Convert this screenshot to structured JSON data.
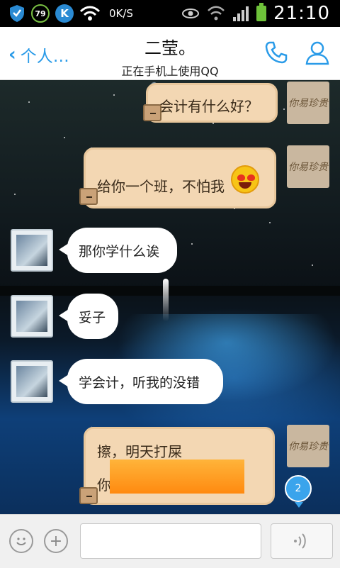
{
  "status_bar": {
    "battery_level_text": "79",
    "k_badge": "K",
    "net_speed": "0K/S",
    "time": "21:10"
  },
  "header": {
    "back_label": "个人…",
    "title": "二莹。",
    "subtitle": "正在手机上使用QQ"
  },
  "messages": [
    {
      "side": "right",
      "text": "会计有什么好？",
      "avatar_text": "你易珍贵"
    },
    {
      "side": "right",
      "text": "给你一个班，不怕我",
      "avatar_text": "你易珍贵",
      "emoji": "heart-eyes-emoji"
    },
    {
      "side": "left",
      "text": "那你学什么诶"
    },
    {
      "side": "left",
      "text": "妥子"
    },
    {
      "side": "left",
      "text": "学会计，听我的没错"
    },
    {
      "side": "right",
      "text": "擦，明天打屎",
      "text2": "你",
      "avatar_text": "你易珍贵"
    }
  ],
  "unread_badge": "2",
  "input_bar": {
    "placeholder": ""
  },
  "colors": {
    "accent": "#2a9be8",
    "bubble_right": "#f3d7b3",
    "bubble_left": "#ffffff"
  }
}
